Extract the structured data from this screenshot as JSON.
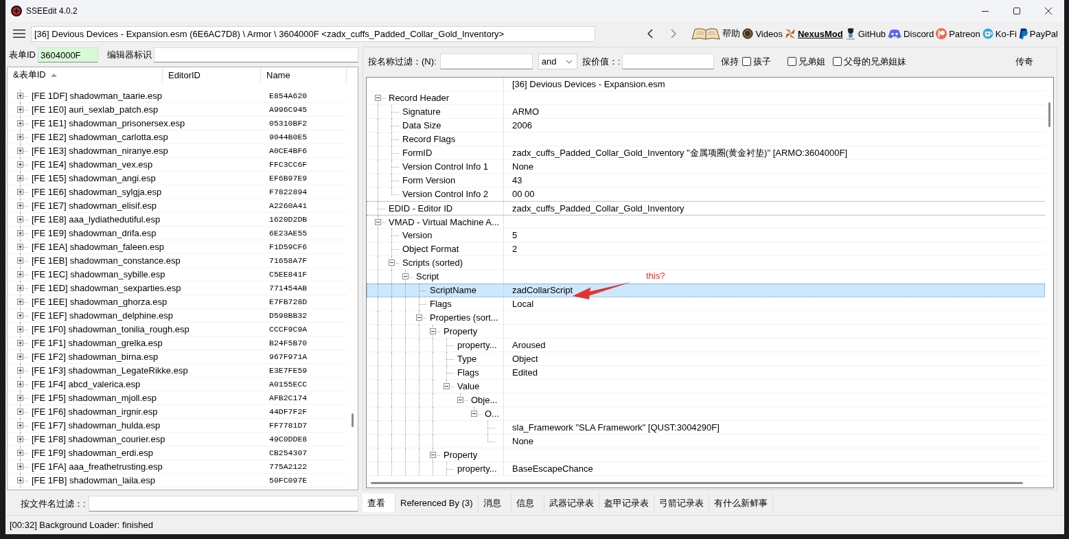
{
  "window": {
    "title": "SSEEdit 4.0.2"
  },
  "toolbar": {
    "path": "[36] Devious Devices - Expansion.esm (6E6AC7D8) \\ Armor \\ 3604000F <zadx_cuffs_Padded_Collar_Gold_Inventory>",
    "links": [
      {
        "label": "帮助"
      },
      {
        "label": "Videos"
      },
      {
        "label": "NexusMod"
      },
      {
        "label": "GitHub"
      },
      {
        "label": "Discord"
      },
      {
        "label": "Patreon"
      },
      {
        "label": "Ko-Fi"
      },
      {
        "label": "PayPal"
      }
    ]
  },
  "left_panel": {
    "form_id": {
      "label": "表单ID",
      "value": "3604000F"
    },
    "editor_id": {
      "label": "编辑器标识"
    },
    "list": {
      "columns": [
        {
          "label": "&表单ID",
          "sorted": true
        },
        {
          "label": "EditorID",
          "sorted": false
        },
        {
          "label": "Name",
          "sorted": false
        }
      ],
      "rows": [
        {
          "form_id": "[FE 1DF] shadowman_taarie.esp",
          "name": "E854A620",
          "expanded": false,
          "selected": false
        },
        {
          "form_id": "[FE 1E0] auri_sexlab_patch.esp",
          "name": "A996C945",
          "expanded": false,
          "selected": false
        },
        {
          "form_id": "[FE 1E1] shadowman_prisonersex.esp",
          "name": "05310BF2",
          "expanded": false,
          "selected": false
        },
        {
          "form_id": "[FE 1E2] shadowman_carlotta.esp",
          "name": "9044B0E5",
          "expanded": false,
          "selected": false
        },
        {
          "form_id": "[FE 1E3] shadowman_niranye.esp",
          "name": "A0CE4BF6",
          "expanded": false,
          "selected": false
        },
        {
          "form_id": "[FE 1E4] shadowman_vex.esp",
          "name": "FFC3CC6F",
          "expanded": false,
          "selected": false
        },
        {
          "form_id": "[FE 1E5] shadowman_angi.esp",
          "name": "EF6B97E9",
          "expanded": false,
          "selected": false
        },
        {
          "form_id": "[FE 1E6] shadowman_sylgja.esp",
          "name": "F7822894",
          "expanded": false,
          "selected": false
        },
        {
          "form_id": "[FE 1E7] shadowman_elisif.esp",
          "name": "A2260A41",
          "expanded": false,
          "selected": false
        },
        {
          "form_id": "[FE 1E8] aaa_lydiathedutiful.esp",
          "name": "1620D2DB",
          "expanded": false,
          "selected": false
        },
        {
          "form_id": "[FE 1E9] shadowman_drifa.esp",
          "name": "6E23AE55",
          "expanded": false,
          "selected": false
        },
        {
          "form_id": "[FE 1EA] shadowman_faleen.esp",
          "name": "F1D59CF6",
          "expanded": false,
          "selected": false
        },
        {
          "form_id": "[FE 1EB] shadowman_constance.esp",
          "name": "71658A7F",
          "expanded": false,
          "selected": false
        },
        {
          "form_id": "[FE 1EC] shadowman_sybille.esp",
          "name": "C5EE841F",
          "expanded": false,
          "selected": false
        },
        {
          "form_id": "[FE 1ED] shadowman_sexparties.esp",
          "name": "771454AB",
          "expanded": false,
          "selected": false
        },
        {
          "form_id": "[FE 1EE] shadowman_ghorza.esp",
          "name": "E7FB728D",
          "expanded": false,
          "selected": false
        },
        {
          "form_id": "[FE 1EF] shadowman_delphine.esp",
          "name": "D598BB32",
          "expanded": false,
          "selected": false
        },
        {
          "form_id": "[FE 1F0] shadowman_tonilia_rough.esp",
          "name": "CCCF9C9A",
          "expanded": false,
          "selected": false
        },
        {
          "form_id": "[FE 1F1] shadowman_grelka.esp",
          "name": "B24F5B70",
          "expanded": false,
          "selected": false
        },
        {
          "form_id": "[FE 1F2] shadowman_birna.esp",
          "name": "967F971A",
          "expanded": false,
          "selected": false
        },
        {
          "form_id": "[FE 1F3] shadowman_LegateRikke.esp",
          "name": "E3E7FE59",
          "expanded": false,
          "selected": false
        },
        {
          "form_id": "[FE 1F4] abcd_valerica.esp",
          "name": "A0155ECC",
          "expanded": false,
          "selected": false
        },
        {
          "form_id": "[FE 1F5] shadowman_mjoll.esp",
          "name": "AFB2C174",
          "expanded": false,
          "selected": false
        },
        {
          "form_id": "[FE 1F6] shadowman_irgnir.esp",
          "name": "44DF7F2F",
          "expanded": false,
          "selected": false
        },
        {
          "form_id": "[FE 1F7] shadowman_hulda.esp",
          "name": "FF7781D7",
          "expanded": false,
          "selected": false
        },
        {
          "form_id": "[FE 1F8] shadowman_courier.esp",
          "name": "49C0DDE8",
          "expanded": false,
          "selected": false
        },
        {
          "form_id": "[FE 1F9] shadowman_erdi.esp",
          "name": "CB254307",
          "expanded": false,
          "selected": false
        },
        {
          "form_id": "[FE 1FA] aaa_freathetrusting.esp",
          "name": "775A2122",
          "expanded": false,
          "selected": false
        },
        {
          "form_id": "[FE 1FB] shadowman_laila.esp",
          "name": "50FC097E",
          "expanded": false,
          "selected": false
        }
      ]
    },
    "file_filter": {
      "label": "按文件名过滤：:"
    }
  },
  "right_panel": {
    "filter": {
      "name_label": "按名称过滤：(N):",
      "operator": "and",
      "value_label": "按价值：:",
      "keep_label": "保持",
      "options": [
        {
          "label": "孩子",
          "checked": false
        },
        {
          "label": "兄弟姐",
          "checked": false
        },
        {
          "label": "父母的兄弟姐妹",
          "checked": false
        }
      ],
      "legend": "传奇"
    },
    "tree": {
      "header_value": "[36] Devious Devices - Expansion.esm",
      "nodes": [
        {
          "name": "Record Header",
          "expanded": true,
          "selected": false,
          "children": [
            {
              "name": "Signature",
              "value": "ARMO",
              "selected": false
            },
            {
              "name": "Data Size",
              "value": "2006",
              "selected": false
            },
            {
              "name": "Record Flags",
              "selected": false
            },
            {
              "name": "FormID",
              "value": "zadx_cuffs_Padded_Collar_Gold_Inventory \"金属项圈(黄金衬垫)\" [ARMO:3604000F]",
              "selected": false
            },
            {
              "name": "Version Control Info 1",
              "value": "None",
              "selected": false
            },
            {
              "name": "Form Version",
              "value": "43",
              "selected": false
            },
            {
              "name": "Version Control Info 2",
              "value": "00 00",
              "selected": false
            }
          ]
        },
        {
          "name": "EDID - Editor ID",
          "value": "zadx_cuffs_Padded_Collar_Gold_Inventory",
          "selected": false
        },
        {
          "name": "VMAD - Virtual Machine A...",
          "expanded": true,
          "selected": false,
          "children": [
            {
              "name": "Version",
              "value": "5",
              "selected": false
            },
            {
              "name": "Object Format",
              "value": "2",
              "selected": false
            },
            {
              "name": "Scripts (sorted)",
              "expanded": true,
              "selected": false,
              "children": [
                {
                  "name": "Script",
                  "expanded": true,
                  "selected": false,
                  "children": [
                    {
                      "name": "ScriptName",
                      "value": "zadCollarScript",
                      "selected": true
                    },
                    {
                      "name": "Flags",
                      "value": "Local",
                      "selected": false
                    },
                    {
                      "name": "Properties (sort...",
                      "expanded": true,
                      "selected": false,
                      "children": [
                        {
                          "name": "Property",
                          "expanded": true,
                          "selected": false,
                          "children": [
                            {
                              "name": "property...",
                              "value": "Aroused",
                              "selected": false
                            },
                            {
                              "name": "Type",
                              "value": "Object",
                              "selected": false
                            },
                            {
                              "name": "Flags",
                              "value": "Edited",
                              "selected": false
                            },
                            {
                              "name": "Value",
                              "expanded": true,
                              "selected": false,
                              "children": [
                                {
                                  "name": "Obje...",
                                  "expanded": true,
                                  "selected": false,
                                  "children": [
                                    {
                                      "name": "O...",
                                      "expanded": true,
                                      "selected": false,
                                      "children": [
                                        {
                                          "value": "sla_Framework \"SLA Framework\" [QUST:3004290F]",
                                          "selected": false
                                        },
                                        {
                                          "value": "None",
                                          "selected": false
                                        }
                                      ]
                                    }
                                  ]
                                }
                              ]
                            }
                          ]
                        },
                        {
                          "name": "Property",
                          "expanded": true,
                          "selected": false,
                          "children": [
                            {
                              "name": "property...",
                              "value": "BaseEscapeChance",
                              "selected": false
                            }
                          ]
                        }
                      ]
                    }
                  ]
                }
              ]
            }
          ]
        }
      ]
    },
    "annotation": {
      "text": "this?"
    },
    "tabs": [
      {
        "label": "查看",
        "selected": true
      },
      {
        "label": "Referenced By (3)",
        "selected": false
      },
      {
        "label": "消息",
        "selected": false
      },
      {
        "label": "信息",
        "selected": false
      },
      {
        "label": "武器记录表",
        "selected": false
      },
      {
        "label": "盔甲记录表",
        "selected": false
      },
      {
        "label": "弓箭记录表",
        "selected": false
      },
      {
        "label": "有什么新鲜事",
        "selected": false
      }
    ]
  },
  "status_bar": {
    "text": "[00:32] Background Loader: finished"
  }
}
